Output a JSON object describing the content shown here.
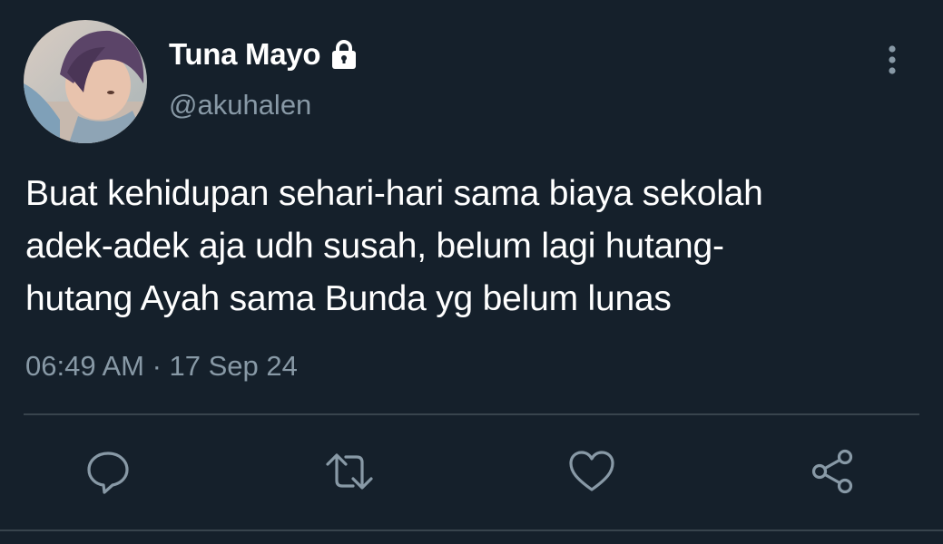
{
  "user": {
    "display_name": "Tuna Mayo",
    "handle": "@akuhalen",
    "avatar_icon": "avatar",
    "protected_icon": "lock-icon"
  },
  "tweet": {
    "text": "Buat kehidupan sehari-hari sama biaya sekolah adek-adek aja udh susah, belum lagi hutang-hutang Ayah sama Bunda yg belum lunas",
    "lines": [
      "Buat kehidupan sehari-hari sama biaya sekolah",
      "adek-adek aja udh susah, belum lagi hutang-",
      "hutang Ayah sama Bunda yg belum lunas"
    ],
    "timestamp": "06:49 AM · 17 Sep 24"
  },
  "actions": [
    {
      "name": "reply",
      "icon": "reply-icon"
    },
    {
      "name": "retweet",
      "icon": "retweet-icon"
    },
    {
      "name": "like",
      "icon": "heart-icon"
    },
    {
      "name": "share",
      "icon": "share-icon"
    }
  ],
  "colors": {
    "background": "#15202b",
    "primary_text": "#ffffff",
    "secondary_text": "#8899a6",
    "divider": "#38444d"
  }
}
